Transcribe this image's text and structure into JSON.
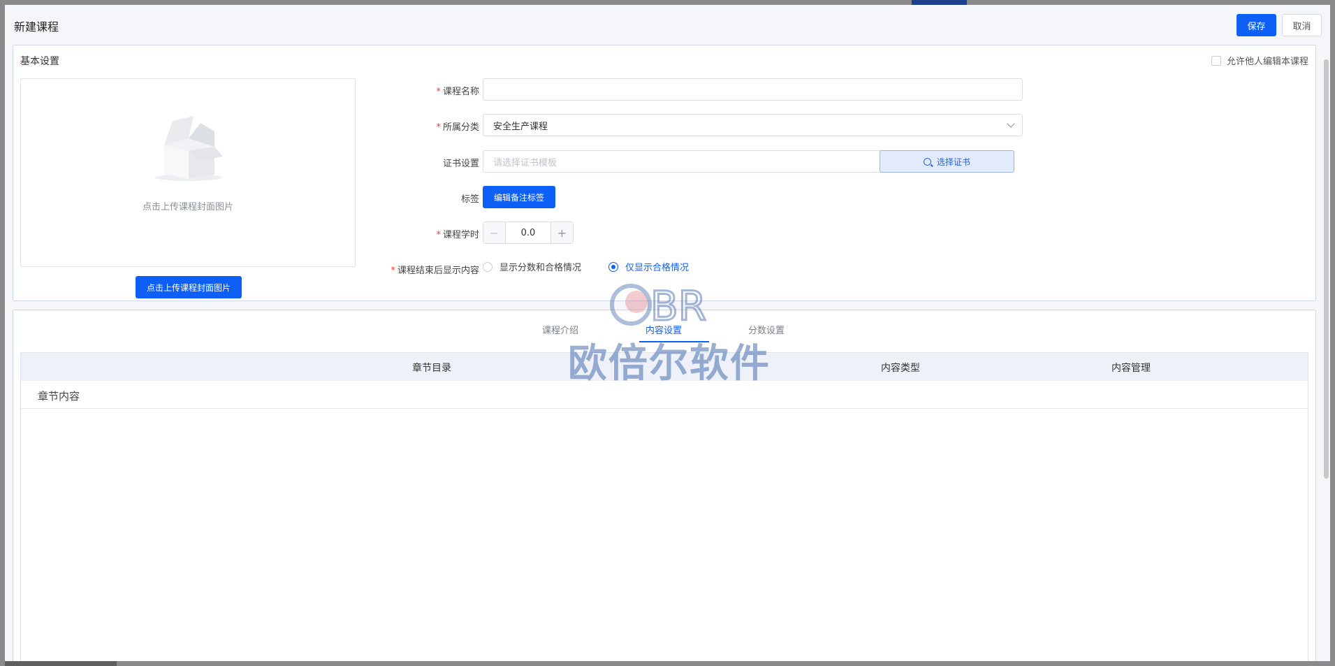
{
  "dialog": {
    "title": "新建课程",
    "save_label": "保存",
    "cancel_label": "取消"
  },
  "basic": {
    "section_title": "基本设置",
    "allow_edit_label": "允许他人编辑本课程",
    "allow_edit_checked": false,
    "cover_hint": "点击上传课程封面图片",
    "upload_button_label": "点击上传课程封面图片"
  },
  "form": {
    "course_name": {
      "label": "课程名称",
      "required": true,
      "value": ""
    },
    "category": {
      "label": "所属分类",
      "required": true,
      "value": "安全生产课程"
    },
    "certificate": {
      "label": "证书设置",
      "placeholder": "请选择证书模板",
      "button_label": "选择证书"
    },
    "tags": {
      "label": "标签",
      "button_label": "编辑备注标签"
    },
    "hours": {
      "label": "课程学时",
      "required": true,
      "value": "0.0",
      "minus": "−",
      "plus": "+"
    },
    "after_display": {
      "label": "课程结束后显示内容",
      "required": true,
      "options": [
        "显示分数和合格情况",
        "仅显示合格情况"
      ],
      "selected": "仅显示合格情况"
    }
  },
  "tabs": {
    "items": [
      "课程介绍",
      "内容设置",
      "分数设置"
    ],
    "active": "内容设置"
  },
  "table": {
    "headers": [
      "章节目录",
      "内容类型",
      "内容管理"
    ],
    "rows": [
      [
        "章节内容"
      ]
    ]
  },
  "watermark": {
    "logo_text": "BR",
    "text": "欧倍尔软件"
  },
  "colors": {
    "primary": "#0d5ff5",
    "required": "#f04134",
    "header_bg": "#eef2f8"
  }
}
